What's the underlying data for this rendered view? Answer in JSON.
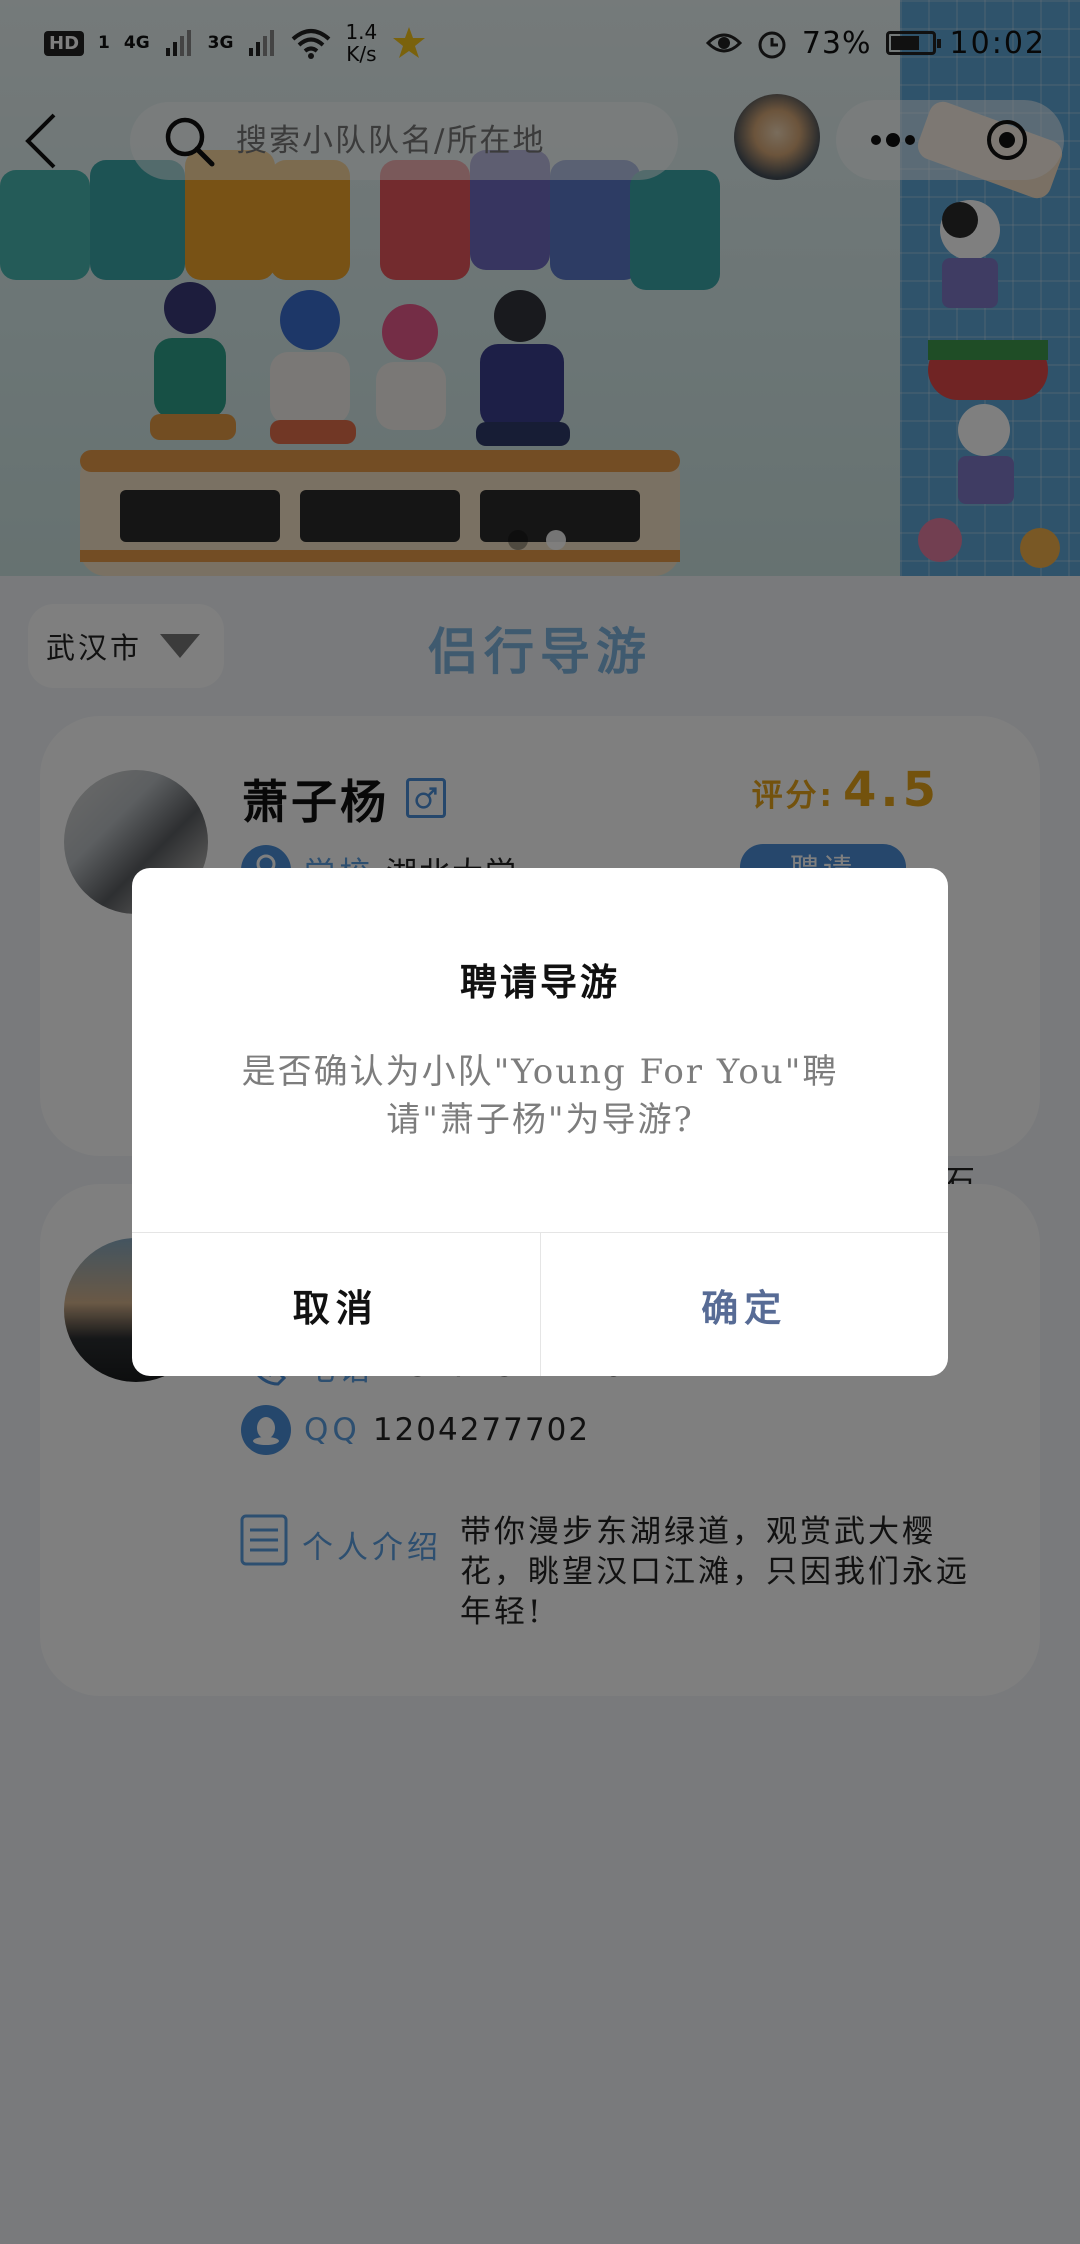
{
  "status_bar": {
    "hd": "HD",
    "sim_slot": "1",
    "net1": "4G",
    "net2": "3G",
    "speed_value": "1.4",
    "speed_unit": "K/s",
    "battery_percent": "73%",
    "battery_level": 0.73,
    "time": "10:02"
  },
  "nav": {
    "search_placeholder": "搜索小队队名/所在地"
  },
  "banner": {
    "slide_count": 2,
    "active_slide": 1
  },
  "filter": {
    "city": "武汉市"
  },
  "section_title": "侣行导游",
  "guides": [
    {
      "name": "萧子杨",
      "gender_icon": "male-icon",
      "rating_label": "评分:",
      "rating_value": "4.5",
      "hire_label": "聘请",
      "school_label": "学校",
      "school_value": "湖北大学",
      "overflow_char": "石"
    },
    {
      "phone_label": "电话",
      "phone_value": "18271822146",
      "qq_label": "QQ",
      "qq_value": "1204277702",
      "intro_label": "个人介绍",
      "intro_text": "带你漫步东湖绿道，观赏武大樱花，眺望汉口江滩，只因我们永远年轻!"
    }
  ],
  "dialog": {
    "title": "聘请导游",
    "message": "是否确认为小队\"Young For You\"聘请\"萧子杨\"为导游?",
    "cancel_label": "取消",
    "confirm_label": "确定"
  },
  "colors": {
    "accent_blue": "#5b9ee0",
    "rating_gold": "#e6a51a",
    "confirm_text": "#576b95",
    "mask": "rgba(0,0,0,0.5)"
  }
}
